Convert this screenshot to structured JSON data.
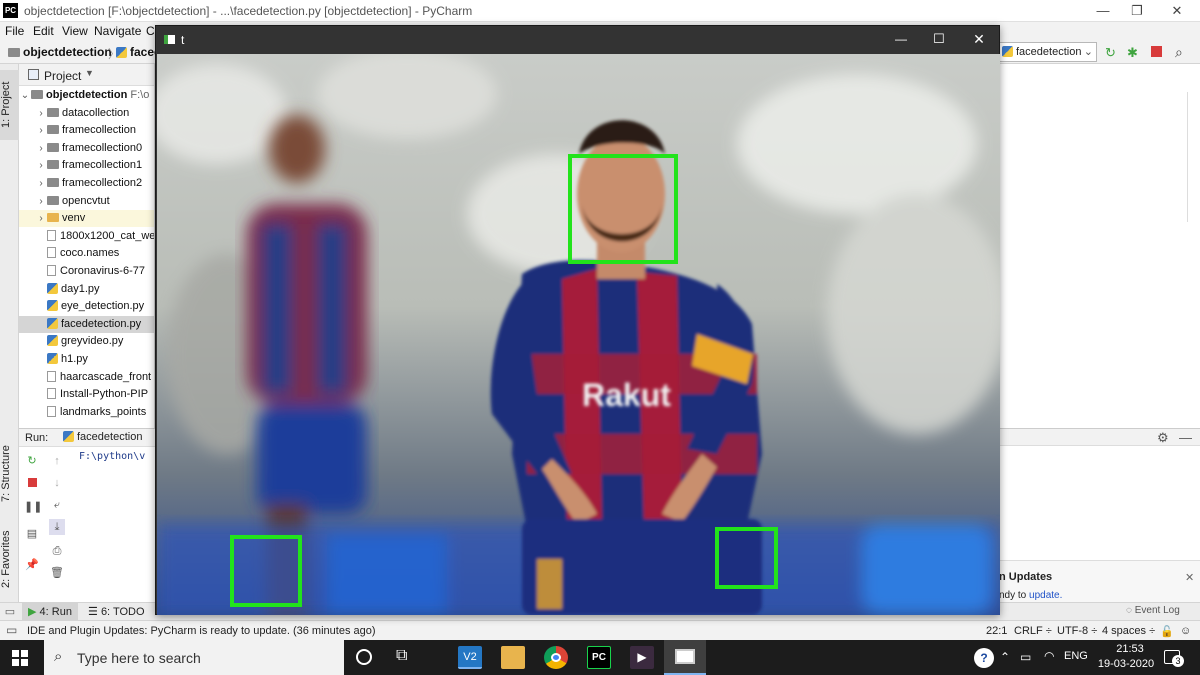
{
  "titlebar": {
    "logo": "PC",
    "title": "objectdetection [F:\\objectdetection] - ...\\facedetection.py [objectdetection] - PyCharm",
    "minimize": "—",
    "restore": "❐",
    "close": "✕"
  },
  "menu": [
    "File",
    "Edit",
    "View",
    "Navigate",
    "C"
  ],
  "breadcrumb": {
    "project": "objectdetection",
    "file": "facec"
  },
  "run_config": {
    "label": "facedetection"
  },
  "left_tabs": {
    "project": "1: Project",
    "structure": "7: Structure",
    "favorites": "2: Favorites"
  },
  "project_pane": {
    "header": "Project",
    "root": {
      "name": "objectdetection",
      "path": "F:\\o"
    },
    "items": [
      {
        "name": "datacollection",
        "kind": "folder"
      },
      {
        "name": "framecollection",
        "kind": "folder"
      },
      {
        "name": "framecollection0",
        "kind": "folder"
      },
      {
        "name": "framecollection1",
        "kind": "folder"
      },
      {
        "name": "framecollection2",
        "kind": "folder"
      },
      {
        "name": "opencvtut",
        "kind": "folder"
      },
      {
        "name": "venv",
        "kind": "venv"
      },
      {
        "name": "1800x1200_cat_we",
        "kind": "file"
      },
      {
        "name": "coco.names",
        "kind": "file"
      },
      {
        "name": "Coronavirus-6-77",
        "kind": "file"
      },
      {
        "name": "day1.py",
        "kind": "py"
      },
      {
        "name": "eye_detection.py",
        "kind": "py"
      },
      {
        "name": "facedetection.py",
        "kind": "py"
      },
      {
        "name": "greyvideo.py",
        "kind": "py"
      },
      {
        "name": "h1.py",
        "kind": "py"
      },
      {
        "name": "haarcascade_front",
        "kind": "file"
      },
      {
        "name": "Install-Python-PIP",
        "kind": "file"
      },
      {
        "name": "landmarks_points",
        "kind": "file"
      }
    ]
  },
  "run_pane": {
    "label": "Run:",
    "tab": "facedetection",
    "output": "F:\\python\\v"
  },
  "bottom_tabs": {
    "run": "4: Run",
    "todo": "6: TODO",
    "event_log": "Event Log"
  },
  "notification": {
    "title": "n Updates",
    "text_prefix": "ndy to",
    "link": "update."
  },
  "status": {
    "message": "IDE and Plugin Updates: PyCharm is ready to update. (36 minutes ago)",
    "position": "22:1",
    "line_sep": "CRLF ÷",
    "encoding": "UTF-8 ÷",
    "indent": "4 spaces ÷"
  },
  "opencv_window": {
    "title": "t",
    "minimize": "—",
    "maximize": "☐",
    "close": "✕"
  },
  "taskbar": {
    "search_placeholder": "Type here to search",
    "language": "ENG",
    "time": "21:53",
    "date": "19-03-2020",
    "notifications": "3"
  },
  "colors": {
    "detection_box": "#22e31b",
    "jersey_blue": "#1b2f7a",
    "jersey_red": "#a51e3a"
  },
  "detections": 3
}
